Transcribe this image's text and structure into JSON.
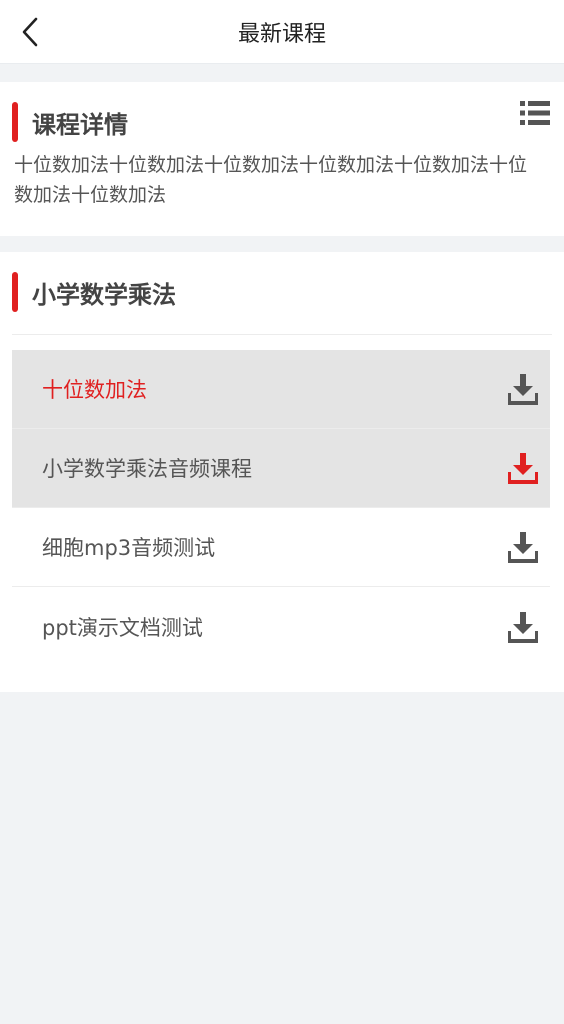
{
  "header": {
    "title": "最新课程",
    "back_icon": "chevron-left-icon"
  },
  "detail": {
    "title": "课程详情",
    "menu_icon": "list-icon",
    "text": "十位数加法十位数加法十位数加法十位数加法十位数加法十位数加法十位数加法"
  },
  "course": {
    "title": "小学数学乘法",
    "items": [
      {
        "label": "十位数加法",
        "download_icon": "download-icon",
        "active": true,
        "label_color": "#e02020",
        "icon_color": "#555555"
      },
      {
        "label": "小学数学乘法音频课程",
        "download_icon": "download-icon",
        "active": true,
        "label_color": "#555555",
        "icon_color": "#e02020"
      },
      {
        "label": "细胞mp3音频测试",
        "download_icon": "download-icon",
        "active": false,
        "label_color": "#555555",
        "icon_color": "#555555"
      },
      {
        "label": "ppt演示文档测试",
        "download_icon": "download-icon",
        "active": false,
        "label_color": "#555555",
        "icon_color": "#555555"
      }
    ]
  },
  "colors": {
    "accent": "#e02020",
    "background": "#f1f3f5",
    "row_active": "#e4e4e4"
  }
}
